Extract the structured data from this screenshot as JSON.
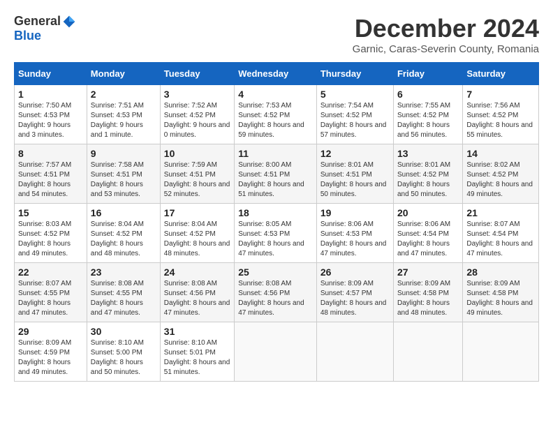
{
  "header": {
    "logo_general": "General",
    "logo_blue": "Blue",
    "title": "December 2024",
    "subtitle": "Garnic, Caras-Severin County, Romania"
  },
  "days_of_week": [
    "Sunday",
    "Monday",
    "Tuesday",
    "Wednesday",
    "Thursday",
    "Friday",
    "Saturday"
  ],
  "weeks": [
    [
      {
        "day": "1",
        "sunrise": "Sunrise: 7:50 AM",
        "sunset": "Sunset: 4:53 PM",
        "daylight": "Daylight: 9 hours and 3 minutes."
      },
      {
        "day": "2",
        "sunrise": "Sunrise: 7:51 AM",
        "sunset": "Sunset: 4:53 PM",
        "daylight": "Daylight: 9 hours and 1 minute."
      },
      {
        "day": "3",
        "sunrise": "Sunrise: 7:52 AM",
        "sunset": "Sunset: 4:52 PM",
        "daylight": "Daylight: 9 hours and 0 minutes."
      },
      {
        "day": "4",
        "sunrise": "Sunrise: 7:53 AM",
        "sunset": "Sunset: 4:52 PM",
        "daylight": "Daylight: 8 hours and 59 minutes."
      },
      {
        "day": "5",
        "sunrise": "Sunrise: 7:54 AM",
        "sunset": "Sunset: 4:52 PM",
        "daylight": "Daylight: 8 hours and 57 minutes."
      },
      {
        "day": "6",
        "sunrise": "Sunrise: 7:55 AM",
        "sunset": "Sunset: 4:52 PM",
        "daylight": "Daylight: 8 hours and 56 minutes."
      },
      {
        "day": "7",
        "sunrise": "Sunrise: 7:56 AM",
        "sunset": "Sunset: 4:52 PM",
        "daylight": "Daylight: 8 hours and 55 minutes."
      }
    ],
    [
      {
        "day": "8",
        "sunrise": "Sunrise: 7:57 AM",
        "sunset": "Sunset: 4:51 PM",
        "daylight": "Daylight: 8 hours and 54 minutes."
      },
      {
        "day": "9",
        "sunrise": "Sunrise: 7:58 AM",
        "sunset": "Sunset: 4:51 PM",
        "daylight": "Daylight: 8 hours and 53 minutes."
      },
      {
        "day": "10",
        "sunrise": "Sunrise: 7:59 AM",
        "sunset": "Sunset: 4:51 PM",
        "daylight": "Daylight: 8 hours and 52 minutes."
      },
      {
        "day": "11",
        "sunrise": "Sunrise: 8:00 AM",
        "sunset": "Sunset: 4:51 PM",
        "daylight": "Daylight: 8 hours and 51 minutes."
      },
      {
        "day": "12",
        "sunrise": "Sunrise: 8:01 AM",
        "sunset": "Sunset: 4:51 PM",
        "daylight": "Daylight: 8 hours and 50 minutes."
      },
      {
        "day": "13",
        "sunrise": "Sunrise: 8:01 AM",
        "sunset": "Sunset: 4:52 PM",
        "daylight": "Daylight: 8 hours and 50 minutes."
      },
      {
        "day": "14",
        "sunrise": "Sunrise: 8:02 AM",
        "sunset": "Sunset: 4:52 PM",
        "daylight": "Daylight: 8 hours and 49 minutes."
      }
    ],
    [
      {
        "day": "15",
        "sunrise": "Sunrise: 8:03 AM",
        "sunset": "Sunset: 4:52 PM",
        "daylight": "Daylight: 8 hours and 49 minutes."
      },
      {
        "day": "16",
        "sunrise": "Sunrise: 8:04 AM",
        "sunset": "Sunset: 4:52 PM",
        "daylight": "Daylight: 8 hours and 48 minutes."
      },
      {
        "day": "17",
        "sunrise": "Sunrise: 8:04 AM",
        "sunset": "Sunset: 4:52 PM",
        "daylight": "Daylight: 8 hours and 48 minutes."
      },
      {
        "day": "18",
        "sunrise": "Sunrise: 8:05 AM",
        "sunset": "Sunset: 4:53 PM",
        "daylight": "Daylight: 8 hours and 47 minutes."
      },
      {
        "day": "19",
        "sunrise": "Sunrise: 8:06 AM",
        "sunset": "Sunset: 4:53 PM",
        "daylight": "Daylight: 8 hours and 47 minutes."
      },
      {
        "day": "20",
        "sunrise": "Sunrise: 8:06 AM",
        "sunset": "Sunset: 4:54 PM",
        "daylight": "Daylight: 8 hours and 47 minutes."
      },
      {
        "day": "21",
        "sunrise": "Sunrise: 8:07 AM",
        "sunset": "Sunset: 4:54 PM",
        "daylight": "Daylight: 8 hours and 47 minutes."
      }
    ],
    [
      {
        "day": "22",
        "sunrise": "Sunrise: 8:07 AM",
        "sunset": "Sunset: 4:55 PM",
        "daylight": "Daylight: 8 hours and 47 minutes."
      },
      {
        "day": "23",
        "sunrise": "Sunrise: 8:08 AM",
        "sunset": "Sunset: 4:55 PM",
        "daylight": "Daylight: 8 hours and 47 minutes."
      },
      {
        "day": "24",
        "sunrise": "Sunrise: 8:08 AM",
        "sunset": "Sunset: 4:56 PM",
        "daylight": "Daylight: 8 hours and 47 minutes."
      },
      {
        "day": "25",
        "sunrise": "Sunrise: 8:08 AM",
        "sunset": "Sunset: 4:56 PM",
        "daylight": "Daylight: 8 hours and 47 minutes."
      },
      {
        "day": "26",
        "sunrise": "Sunrise: 8:09 AM",
        "sunset": "Sunset: 4:57 PM",
        "daylight": "Daylight: 8 hours and 48 minutes."
      },
      {
        "day": "27",
        "sunrise": "Sunrise: 8:09 AM",
        "sunset": "Sunset: 4:58 PM",
        "daylight": "Daylight: 8 hours and 48 minutes."
      },
      {
        "day": "28",
        "sunrise": "Sunrise: 8:09 AM",
        "sunset": "Sunset: 4:58 PM",
        "daylight": "Daylight: 8 hours and 49 minutes."
      }
    ],
    [
      {
        "day": "29",
        "sunrise": "Sunrise: 8:09 AM",
        "sunset": "Sunset: 4:59 PM",
        "daylight": "Daylight: 8 hours and 49 minutes."
      },
      {
        "day": "30",
        "sunrise": "Sunrise: 8:10 AM",
        "sunset": "Sunset: 5:00 PM",
        "daylight": "Daylight: 8 hours and 50 minutes."
      },
      {
        "day": "31",
        "sunrise": "Sunrise: 8:10 AM",
        "sunset": "Sunset: 5:01 PM",
        "daylight": "Daylight: 8 hours and 51 minutes."
      },
      null,
      null,
      null,
      null
    ]
  ]
}
